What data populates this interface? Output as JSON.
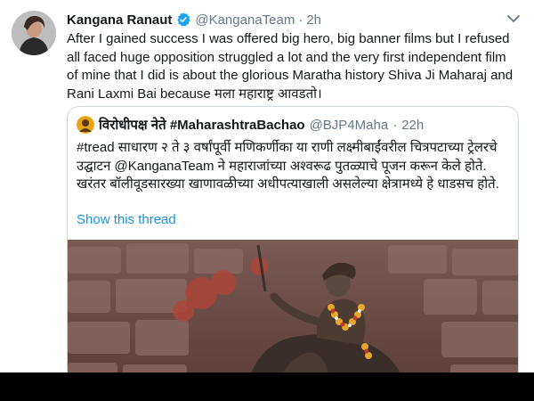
{
  "tweet": {
    "display_name": "Kangana Ranaut",
    "handle": "@KanganaTeam",
    "separator": "·",
    "time": "2h",
    "text": "After I gained success I was offered big hero, big banner films but I refused all faced huge opposition struggled a lot and the very first independent film of mine that I did is about the glorious Maratha history Shiva Ji Maharaj and Rani Laxmi Bai because मला महाराष्ट्र आवडतो।",
    "verified_icon": "verified-badge-icon",
    "menu_icon": "chevron-down-icon",
    "colors": {
      "verified": "#1da1f2",
      "link": "#1b95e0",
      "secondary": "#657786"
    }
  },
  "quoted": {
    "display_name": "विरोधीपक्ष नेते #MaharashtraBachao",
    "handle": "@BJP4Maha",
    "separator": "·",
    "time": "22h",
    "text": "#tread साधारण २ ते ३ वर्षांपूर्वी मणिकर्णीका या राणी लक्ष्मीबाईंवरील चित्रपटाच्या ट्रेलरचे उद्घाटन @KanganaTeam ने महाराजांच्या अश्वरूढ पुतळ्याचे पूजन करून केले होते. खरंतर बॉलीवूडसारख्या खाणावळीच्या अधीपत्याखाली असलेल्या क्षेत्रामध्ये हे धाडसच होते.",
    "show_thread": "Show this thread"
  }
}
